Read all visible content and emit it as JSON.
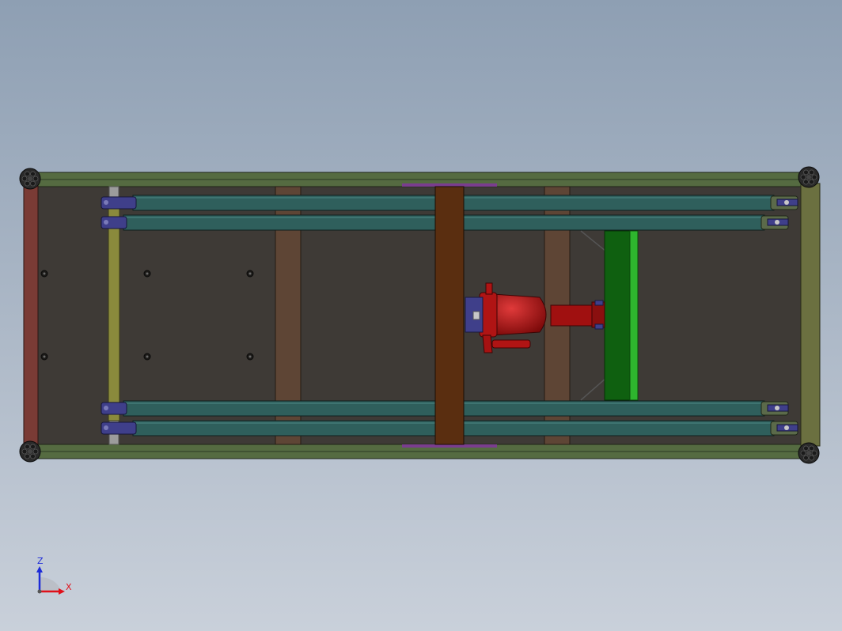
{
  "triad": {
    "vertical_axis_label": "Z",
    "horizontal_axis_label": "X"
  },
  "colors": {
    "background_top": "#8e9fb3",
    "background_bottom": "#c9d0da",
    "base_plate": "#3e3a36",
    "frame_rail": "#556b41",
    "end_plate_left": "#7a3b35",
    "end_plate_right": "#6b7040",
    "linkage_arm": "#2f5f5c",
    "cross_bar": "#5e4535",
    "center_beam": "#5a2e10",
    "pivot_pin": "#8a8a3c",
    "clevis": "#3f3f8a",
    "cylinder": "#b01414",
    "mount_plate_dark": "#0f6010",
    "mount_plate_light": "#2eb52e",
    "accent_strip": "#7a3d8e",
    "axis_z": "#1d2bd8",
    "axis_x": "#e0101a"
  },
  "icons": {
    "corner_caster": "caster-wheel-icon",
    "triad": "coordinate-triad-icon"
  }
}
